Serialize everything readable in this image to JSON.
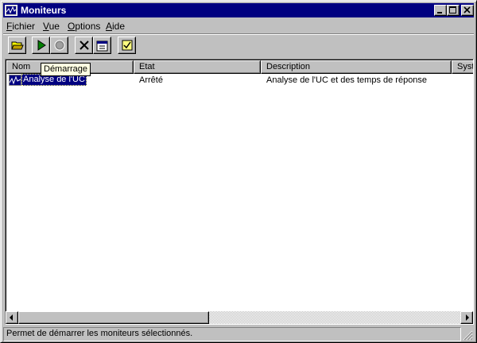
{
  "window": {
    "title": "Moniteurs",
    "icon": "monitor-app-icon"
  },
  "menubar": {
    "items": [
      {
        "u": "F",
        "rest": "ichier"
      },
      {
        "u": "V",
        "rest": "ue"
      },
      {
        "u": "O",
        "rest": "ptions"
      },
      {
        "u": "A",
        "rest": "ide"
      }
    ]
  },
  "toolbar": {
    "buttons": [
      "open-folder-icon",
      "start-play-icon",
      "stop-record-icon",
      "delete-x-icon",
      "properties-icon",
      "checklist-icon"
    ]
  },
  "tooltip": {
    "text": "Démarrage"
  },
  "list": {
    "columns": [
      "Nom",
      "Etat",
      "Description",
      "Système"
    ],
    "rows": [
      {
        "name": "Analyse de l'UC",
        "state": "Arrêté",
        "description": "Analyse de l'UC et des temps de réponse",
        "system": ""
      }
    ]
  },
  "status": {
    "text": "Permet de démarrer les moniteurs sélectionnés."
  },
  "colors": {
    "titlebar": "#000080",
    "face": "#c0c0c0",
    "selection": "#000080",
    "tooltip": "#ffffe1"
  }
}
